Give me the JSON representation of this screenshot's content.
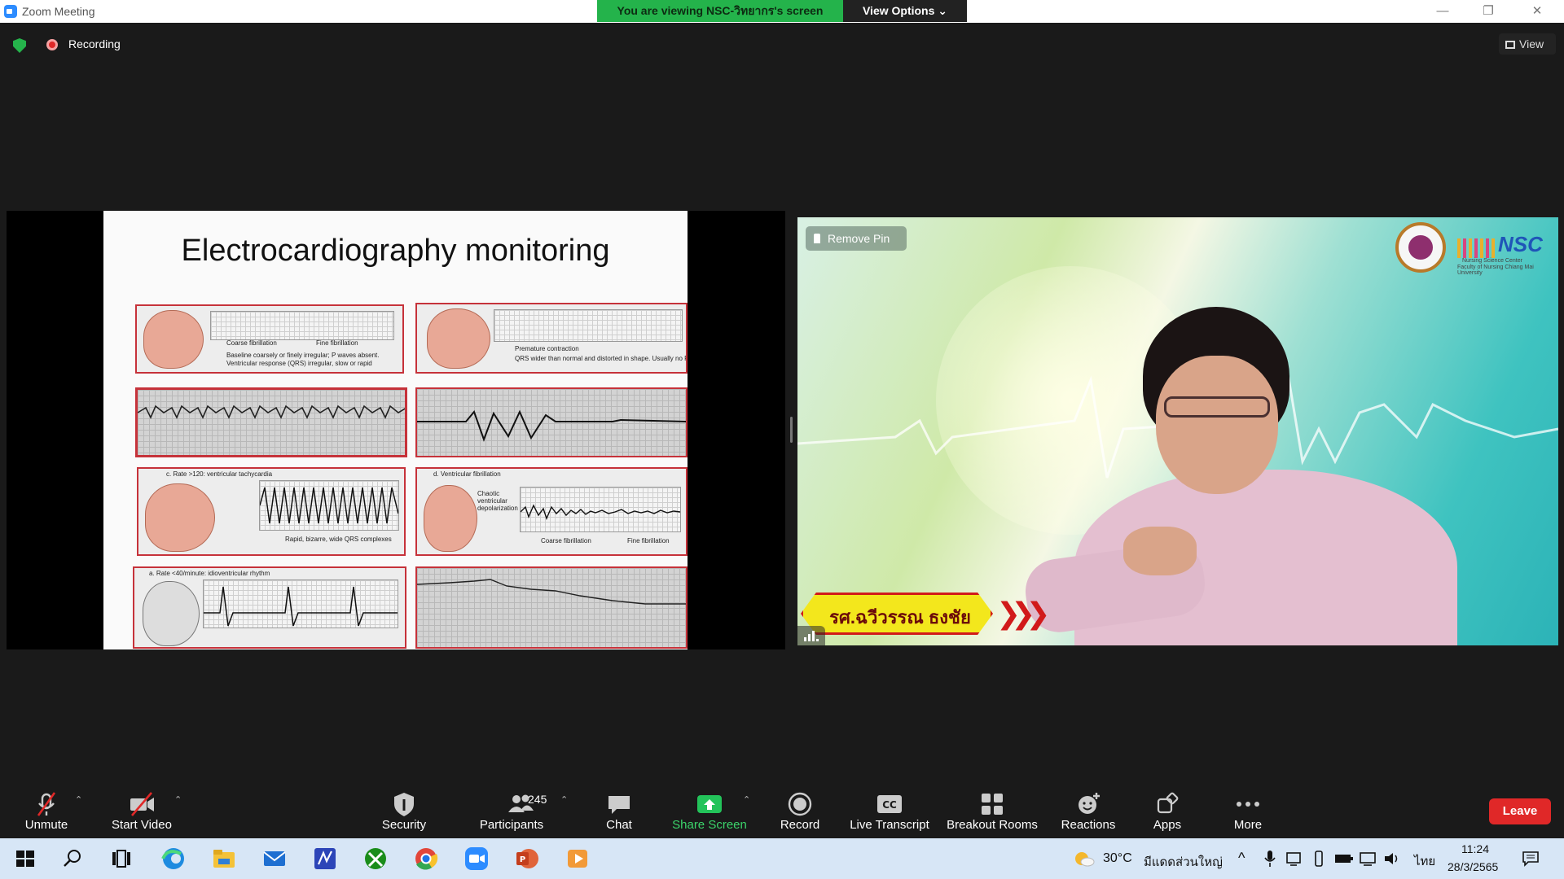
{
  "window": {
    "title": "Zoom Meeting",
    "banner": "You are viewing NSC-วิทยากร's screen",
    "view_options": "View Options"
  },
  "topbar": {
    "recording_label": "Recording",
    "view_label": "View"
  },
  "slide": {
    "title": "Electrocardiography monitoring",
    "captions": [
      "Coarse fibrillation",
      "Fine fibrillation",
      "Baseline coarsely or finely irregular; P waves absent.",
      "Ventricular response (QRS) irregular, slow or rapid",
      "Premature contraction",
      "QRS wider than normal and distorted in shape. Usually no P wave",
      "c. Rate >120: ventricular tachycardia",
      "Rapid, bizarre, wide QRS complexes",
      "d. Ventricular fibrillation",
      "Chaotic ventricular depolarization",
      "Coarse fibrillation",
      "Fine fibrillation",
      "a. Rate <40/minute: idioventricular rhythm"
    ]
  },
  "video": {
    "remove_pin": "Remove Pin",
    "logo_text": "NSC",
    "logo_sub1": "Nursing Science Center",
    "logo_sub2": "Faculty of Nursing Chiang Mai University",
    "speaker_name": "รศ.ฉวีวรรณ ธงชัย"
  },
  "toolbar": {
    "unmute": "Unmute",
    "start_video": "Start Video",
    "security": "Security",
    "participants": "Participants",
    "participants_count": "245",
    "chat": "Chat",
    "share_screen": "Share Screen",
    "record": "Record",
    "live_transcript": "Live Transcript",
    "breakout_rooms": "Breakout Rooms",
    "reactions": "Reactions",
    "apps": "Apps",
    "more": "More",
    "leave": "Leave",
    "cc_text": "CC"
  },
  "taskbar": {
    "weather_temp": "30°C",
    "weather_desc": "มีแดดส่วนใหญ่",
    "language": "ไทย",
    "time": "11:24",
    "date": "28/3/2565"
  },
  "colors": {
    "share_green": "#24b34b",
    "leave_red": "#e02828",
    "accent_blue": "#2d8cff"
  }
}
